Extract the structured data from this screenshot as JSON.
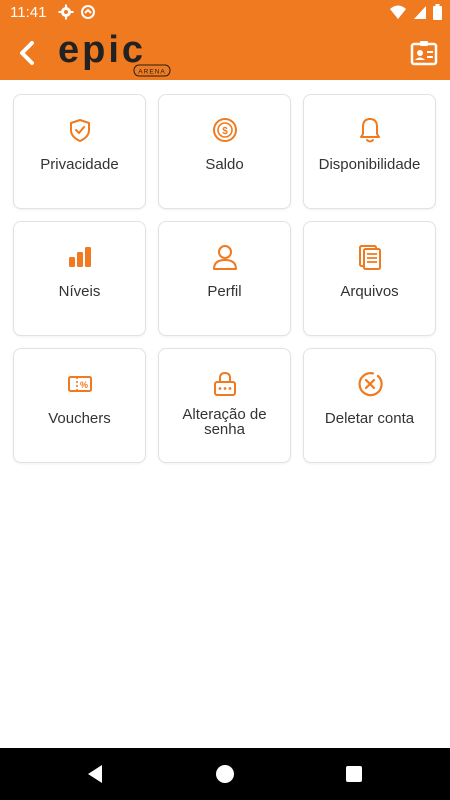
{
  "status": {
    "time": "11:41"
  },
  "header": {
    "logo_text": "epic",
    "logo_sub": "ARENA"
  },
  "tiles": [
    {
      "label": "Privacidade",
      "icon": "shield-check-icon"
    },
    {
      "label": "Saldo",
      "icon": "coin-icon"
    },
    {
      "label": "Disponibilidade",
      "icon": "bell-icon"
    },
    {
      "label": "Níveis",
      "icon": "bar-chart-icon"
    },
    {
      "label": "Perfil",
      "icon": "user-icon"
    },
    {
      "label": "Arquivos",
      "icon": "documents-icon"
    },
    {
      "label": "Vouchers",
      "icon": "voucher-icon"
    },
    {
      "label": "Alteração de senha",
      "icon": "password-icon"
    },
    {
      "label": "Deletar conta",
      "icon": "delete-circle-icon"
    }
  ],
  "colors": {
    "accent": "#F07A1F",
    "text": "#333333",
    "border": "#E2E2E2"
  }
}
